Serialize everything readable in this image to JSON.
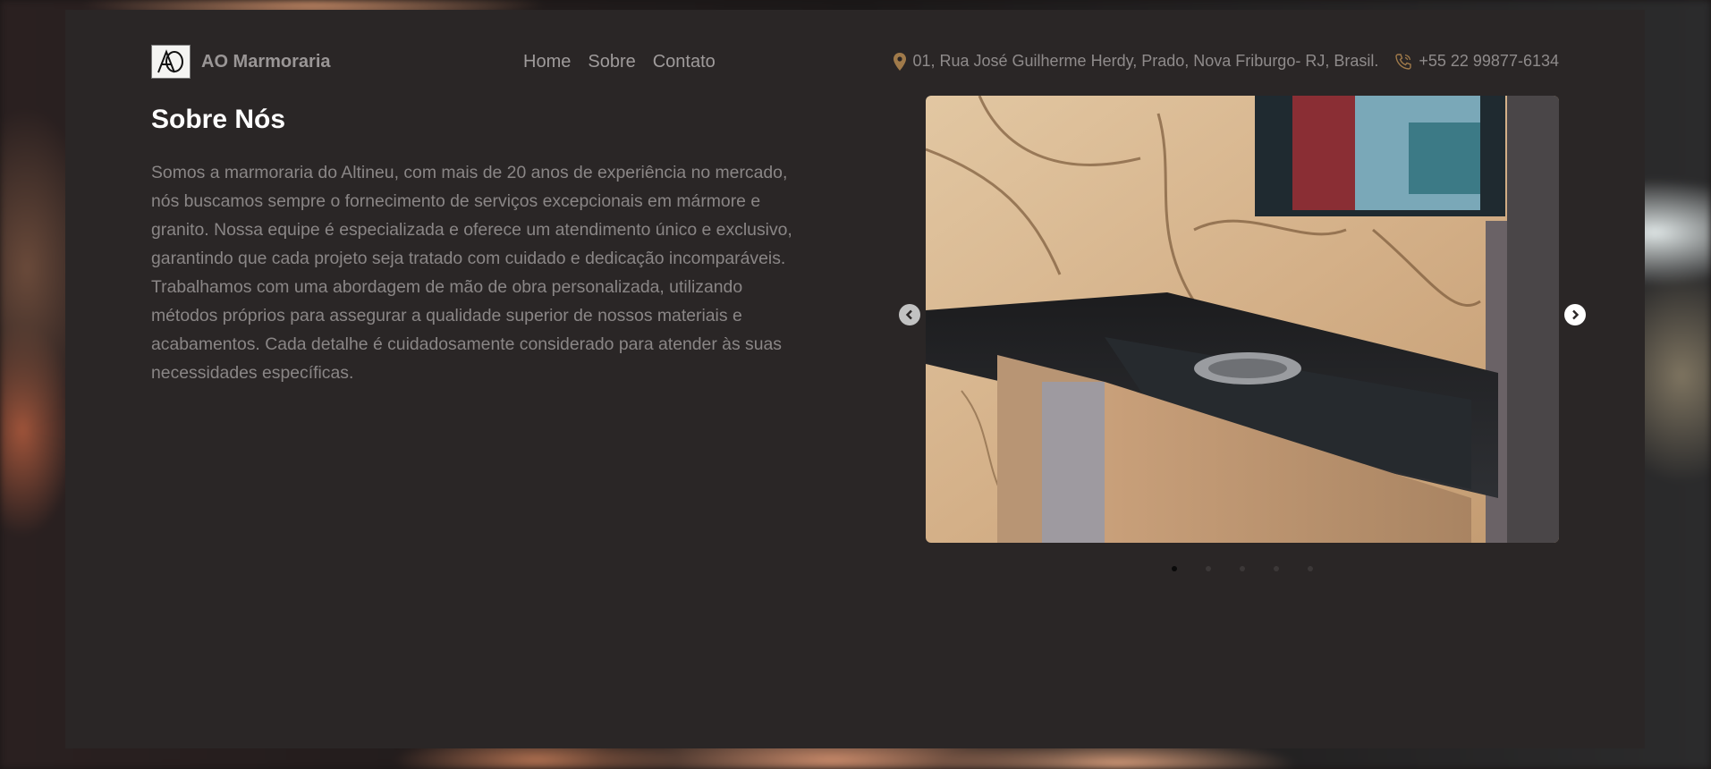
{
  "brand": {
    "name": "AO Marmoraria",
    "logo_text": "AO"
  },
  "nav": [
    {
      "label": "Home"
    },
    {
      "label": "Sobre"
    },
    {
      "label": "Contato"
    }
  ],
  "contact": {
    "address": "01, Rua José Guilherme Herdy, Prado, Nova Friburgo- RJ, Brasil.",
    "phone": "+55 22 99877-6134",
    "address_icon": "location-pin-icon",
    "phone_icon": "phone-icon"
  },
  "about": {
    "title": "Sobre Nós",
    "text": "Somos a marmoraria do Altineu, com mais de 20 anos de experiência no mercado, nós buscamos sempre o fornecimento de serviços excepcionais em mármore e granito. Nossa equipe é especializada e oferece um atendimento único e exclusivo, garantindo que cada projeto seja tratado com cuidado e dedicação incomparáveis. Trabalhamos com uma abordagem de mão de obra personalizada, utilizando métodos próprios para assegurar a qualidade superior de nossos materiais e acabamentos. Cada detalhe é cuidadosamente considerado para atender às suas necessidades específicas."
  },
  "carousel": {
    "slide_count": 5,
    "active_index": 1,
    "prev_icon": "chevron-left-icon",
    "next_icon": "chevron-right-icon"
  },
  "colors": {
    "panel": "#2a2626",
    "accent_icon": "#a07a4a",
    "title": "#ffffff",
    "body_text": "#8a8686"
  }
}
